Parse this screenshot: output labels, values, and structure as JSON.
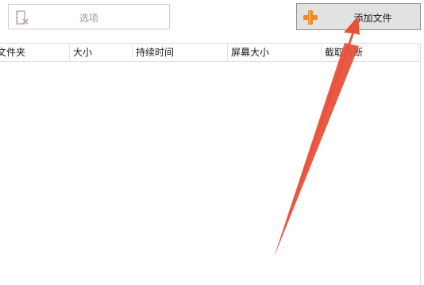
{
  "toolbar": {
    "options_label": "选项",
    "options_icon": "film-settings-icon",
    "add_file_label": "添加文件",
    "add_file_icon": "plus-icon"
  },
  "file_list": {
    "columns": [
      "文件夹",
      "大小",
      "持续时间",
      "屏幕大小",
      "截取片断"
    ],
    "rows": []
  },
  "annotation": {
    "arrow_color": "#e8503a"
  },
  "colors": {
    "plus_icon": "#f0891f",
    "button_face": "#e2e2e2"
  }
}
